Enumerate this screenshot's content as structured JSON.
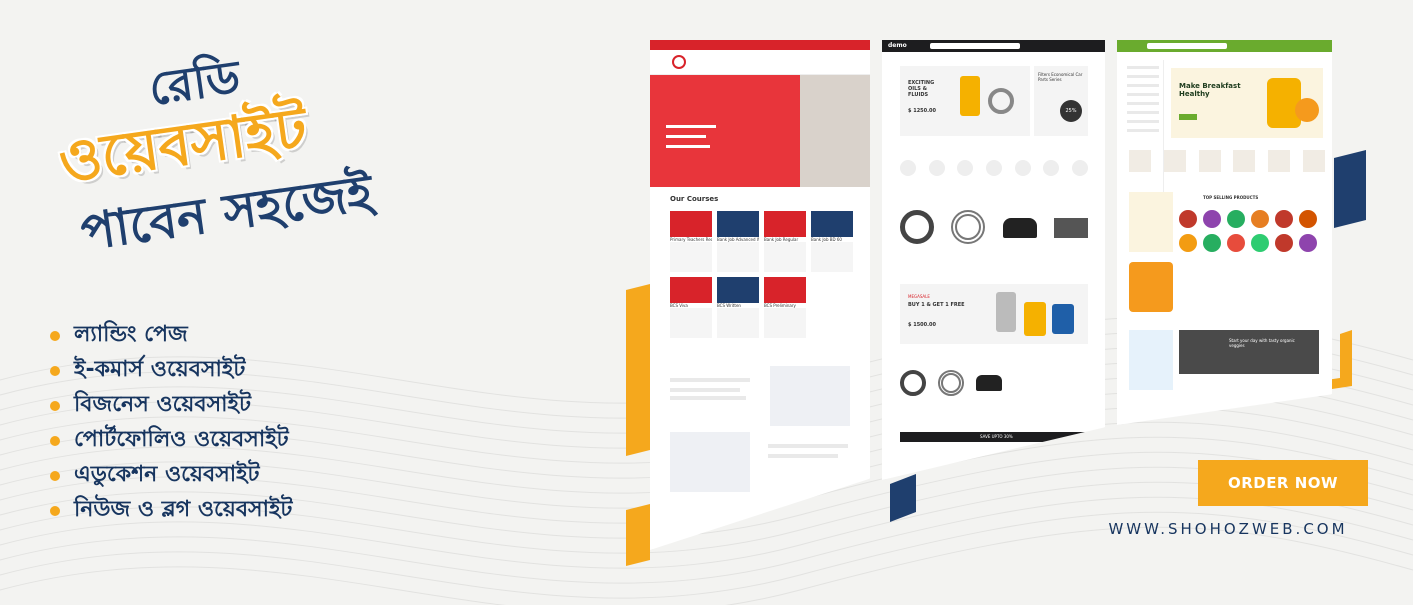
{
  "headline": {
    "line1": "রেডি",
    "line2": "ওয়েবসাইট",
    "line3": "পাবেন সহজেই"
  },
  "features": [
    "ল্যান্ডিং পেজ",
    "ই-কমার্স ওয়েবসাইট",
    "বিজনেস ওয়েবসাইট",
    "পোর্টফোলিও ওয়েবসাইট",
    "এডুকেশন ওয়েবসাইট",
    "নিউজ ও ব্লগ ওয়েবসাইট"
  ],
  "cta": {
    "label": "ORDER NOW"
  },
  "website_url": "WWW.SHOHOZWEB.COM",
  "colors": {
    "navy": "#1f3f6e",
    "orange": "#f5a81d",
    "red": "#d8232a",
    "green": "#6aab2e"
  },
  "mockup1": {
    "section_title": "Our Courses",
    "courses": [
      "Primary Teachers Recruitment...",
      "Bank Job Advanced Written",
      "Bank Job Regular",
      "Bank Job BD 60",
      "BCS Viva",
      "BCS Written",
      "BCS Preliminary"
    ]
  },
  "mockup2": {
    "logo": "demo",
    "hero_title": "EXCITING OILS & FLUIDS",
    "hero_price": "$ 1250.00",
    "side_title": "Filters Economical Car Parts Series",
    "side_discount": "25%",
    "sale_label": "MEGASALE",
    "sale_title": "BUY 1 & GET 1 FREE",
    "sale_price": "$ 1500.00",
    "strip_text": "SAVE UPTO 30%"
  },
  "mockup3": {
    "hero_title": "Make Breakfast Healthy",
    "promo_title": "Start your day with tasty organic veggies",
    "section_title": "TOP SELLING PRODUCTS"
  }
}
